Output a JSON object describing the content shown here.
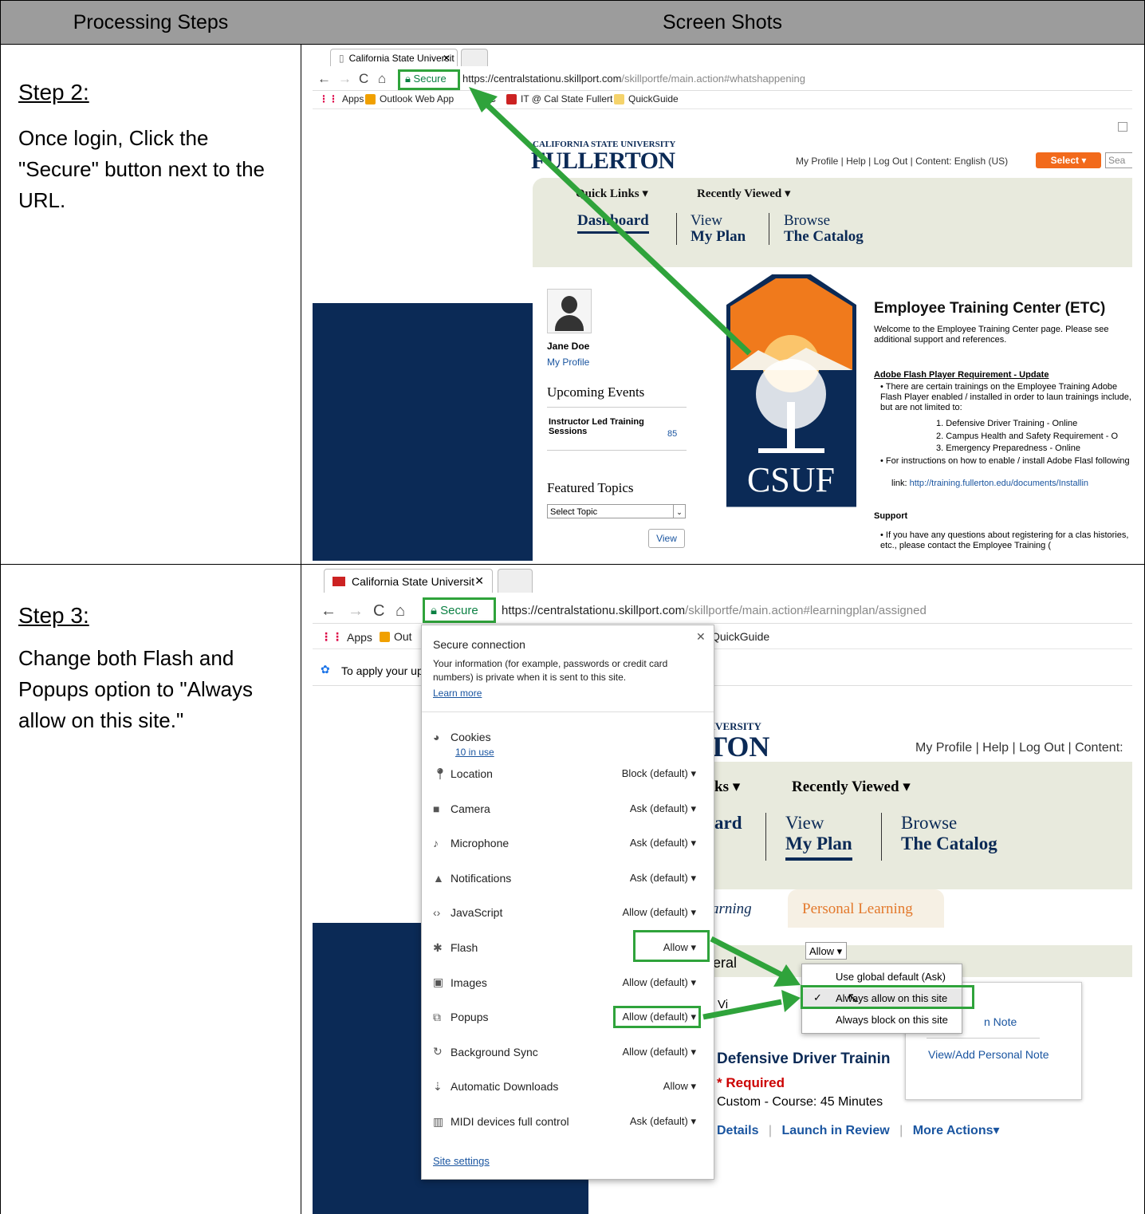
{
  "header": {
    "col1": "Processing Steps",
    "col2": "Screen Shots"
  },
  "step2": {
    "title": "Step 2:",
    "text": "Once login, Click the \"Secure\" button next to the URL.",
    "browser": {
      "tab_title": "California State Universit",
      "secure": "Secure",
      "url_main": "https://centralstationu.skillport.com",
      "url_path": "/skillportfe/main.action#whatshappening",
      "bookmarks": [
        "Apps",
        "Outlook Web App",
        "ETC",
        "IT @ Cal State Fullert",
        "QuickGuide"
      ]
    },
    "site": {
      "univ_small": "CALIFORNIA STATE UNIVERSITY",
      "univ_big": "FULLERTON",
      "toplinks": "My Profile | Help | Log Out | Content: English (US)",
      "select_btn": "Select ▾",
      "search_ph": "Sea",
      "quick_links": "Quick Links ▾",
      "recently_viewed": "Recently Viewed ▾",
      "nav_dashboard": "Dashboard",
      "nav_view1": "View",
      "nav_view2": "My Plan",
      "nav_browse1": "Browse",
      "nav_browse2": "The Catalog",
      "user_name": "Jane Doe",
      "my_profile": "My Profile",
      "upcoming": "Upcoming Events",
      "ilt_label": "Instructor Led Training Sessions",
      "ilt_count": "85",
      "featured": "Featured Topics",
      "select_topic": "Select Topic",
      "view_btn": "View",
      "logo_text": "CSUF",
      "etc_title": "Employee Training Center (ETC)",
      "etc_welcome": "Welcome to the Employee Training Center page. Please see additional support and references.",
      "flash_heading": "Adobe Flash Player Requirement - Update",
      "bullet1": "There are certain trainings on the Employee Training Adobe Flash Player enabled / installed in order to laun trainings include, but are not limited to:",
      "list1": "1. Defensive Driver Training - Online",
      "list2": "2. Campus Health and Safety Requirement - O",
      "list3": "3. Emergency Preparedness - Online",
      "bullet2a": "For instructions on how to enable / install Adobe Flasl following",
      "bullet2b": "link:",
      "bullet2_link": "http://training.fullerton.edu/documents/Installin",
      "support": "Support",
      "support_text": "If you have any questions about registering for a clas histories, etc., please contact the Employee Training ("
    }
  },
  "step3": {
    "title": "Step 3:",
    "text": "Change both Flash and Popups option to \"Always allow on this site.\"",
    "browser": {
      "tab_title": "California State Universit",
      "secure": "Secure",
      "url_main": "https://centralstationu.skillport.com",
      "url_path": "/skillportfe/main.action#learningplan/assigned",
      "bookmarks_apps": "Apps",
      "bookmarks_out": "Out",
      "bookmarks_quick": "QuickGuide",
      "apply_text": "To apply your up"
    },
    "popup": {
      "title": "Secure connection",
      "body": "Your information (for example, passwords or credit card numbers) is private when it is sent to this site.",
      "learn_more": "Learn more",
      "cookies": "Cookies",
      "cookies_sub": "10 in use",
      "rows": [
        {
          "label": "Location",
          "value": "Block (default) ▾"
        },
        {
          "label": "Camera",
          "value": "Ask (default) ▾"
        },
        {
          "label": "Microphone",
          "value": "Ask (default) ▾"
        },
        {
          "label": "Notifications",
          "value": "Ask (default) ▾"
        },
        {
          "label": "JavaScript",
          "value": "Allow (default) ▾"
        },
        {
          "label": "Flash",
          "value": "Allow ▾"
        },
        {
          "label": "Images",
          "value": "Allow (default) ▾"
        },
        {
          "label": "Popups",
          "value": "Allow (default) ▾"
        },
        {
          "label": "Background Sync",
          "value": "Allow (default) ▾"
        },
        {
          "label": "Automatic Downloads",
          "value": "Allow ▾"
        },
        {
          "label": "MIDI devices full control",
          "value": "Ask (default) ▾"
        }
      ],
      "site_settings": "Site settings"
    },
    "site": {
      "univ_small": "IVERSITY",
      "univ_big": "TON",
      "toplinks": "My Profile | Help | Log Out | Content:",
      "quick_links": "ks ▾",
      "recently_viewed": "Recently Viewed ▾",
      "nav_dash": "ard",
      "nav_view1": "View",
      "nav_view2": "My Plan",
      "nav_browse1": "Browse",
      "nav_browse2": "The Catalog",
      "tab_assigned": "arning",
      "tab_personal": "Personal Learning",
      "eral": "eral",
      "vi": "Vi",
      "course_title": "Defensive Driver Trainin",
      "required": "* Required",
      "course_meta": "Custom - Course: 45 Minutes",
      "details": "Details",
      "launch": "Launch in Review",
      "more_actions": "More Actions▾",
      "n_note": "n Note",
      "view_add_note": "View/Add Personal Note"
    },
    "menu": {
      "button": "Allow ▾",
      "items": [
        "Use global default (Ask)",
        "Always allow on this site",
        "Always block on this site"
      ]
    }
  }
}
